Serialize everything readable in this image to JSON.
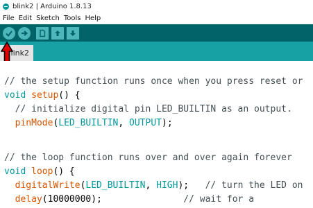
{
  "window": {
    "title": "blink2 | Arduino 1.8.13"
  },
  "menu": {
    "items": [
      "File",
      "Edit",
      "Sketch",
      "Tools",
      "Help"
    ]
  },
  "toolbar": {
    "buttons": [
      {
        "icon": "verify-icon",
        "shape": "round"
      },
      {
        "icon": "upload-icon",
        "shape": "round"
      },
      {
        "icon": "new-icon",
        "shape": "square"
      },
      {
        "icon": "open-icon",
        "shape": "square"
      },
      {
        "icon": "save-icon",
        "shape": "square"
      }
    ]
  },
  "tab": {
    "label": "Blink2",
    "visible_label": "link2"
  },
  "code": {
    "line1": "// the setup function runs once when you press reset or",
    "line2_kw": "void",
    "line2_fn": "setup",
    "line2_rest": "() {",
    "line3": "  // initialize digital pin LED_BUILTIN as an output.",
    "line4_fn": "pinMode",
    "line4_args_open": "(",
    "line4_const1": "LED_BUILTIN",
    "line4_sep": ", ",
    "line4_const2": "OUTPUT",
    "line4_close": ");",
    "line5": "",
    "line6": "// the loop function runs over and over again forever",
    "line7_kw": "void",
    "line7_fn": "loop",
    "line7_rest": "() {",
    "line8_fn": "digitalWrite",
    "line8_open": "(",
    "line8_const1": "LED_BUILTIN",
    "line8_sep": ", ",
    "line8_const2": "HIGH",
    "line8_close": ");",
    "line8_comment": "   // turn the LED on",
    "line9_fn": "delay",
    "line9_rest": "(10000000);",
    "line9_comment": "               // wait for a"
  },
  "colors": {
    "toolbar": "#006468",
    "tabstrip": "#17a1a5",
    "arrow": "#e00000"
  }
}
